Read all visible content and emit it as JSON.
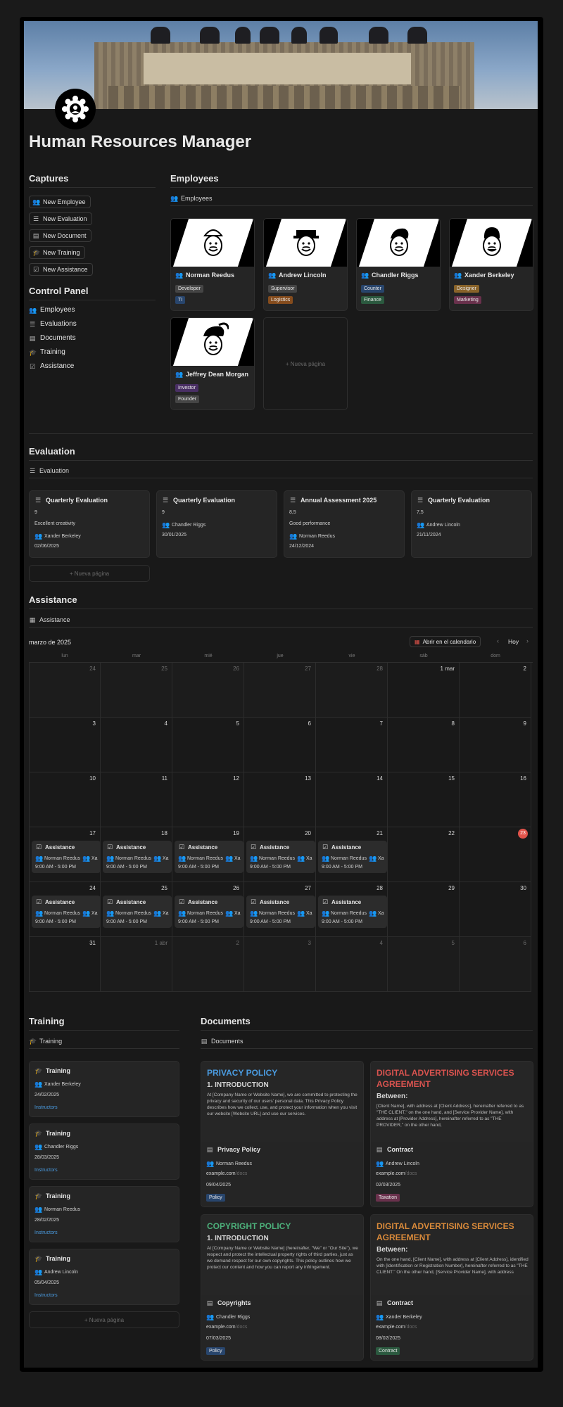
{
  "page": {
    "title": "Human Resources Manager"
  },
  "captures": {
    "heading": "Captures",
    "buttons": [
      "New Employee",
      "New Evaluation",
      "New Document",
      "New Training",
      "New Assistance"
    ]
  },
  "control_panel": {
    "heading": "Control Panel",
    "items": [
      "Employees",
      "Evaluations",
      "Documents",
      "Training",
      "Assistance"
    ]
  },
  "employees": {
    "heading": "Employees",
    "view": "Employees",
    "cards": [
      {
        "name": "Norman Reedus",
        "tags": [
          {
            "label": "Developer",
            "color": "#454545"
          },
          {
            "label": "TI",
            "color": "#28456c"
          }
        ]
      },
      {
        "name": "Andrew Lincoln",
        "tags": [
          {
            "label": "Supervisor",
            "color": "#454545"
          },
          {
            "label": "Logistics",
            "color": "#854c1d"
          }
        ]
      },
      {
        "name": "Chandler Riggs",
        "tags": [
          {
            "label": "Counter",
            "color": "#28456c"
          },
          {
            "label": "Finance",
            "color": "#2b593f"
          }
        ]
      },
      {
        "name": "Xander Berkeley",
        "tags": [
          {
            "label": "Designer",
            "color": "#89632a"
          },
          {
            "label": "Marketing",
            "color": "#69314c"
          }
        ]
      },
      {
        "name": "Jeffrey Dean Morgan",
        "tags": [
          {
            "label": "Investor",
            "color": "#492f64"
          },
          {
            "label": "Founder",
            "color": "#454545"
          }
        ]
      }
    ],
    "new_page": "+ Nueva página"
  },
  "evaluation": {
    "heading": "Evaluation",
    "view": "Evaluation",
    "cards": [
      {
        "title": "Quarterly Evaluation",
        "score": "9",
        "note": "Excellent creativity",
        "person": "Xander Berkeley",
        "date": "02/06/2025"
      },
      {
        "title": "Quarterly Evaluation",
        "score": "9",
        "note": "",
        "person": "Chandler Riggs",
        "date": "30/01/2025"
      },
      {
        "title": "Annual Assessment 2025",
        "score": "8,5",
        "note": "Good performance",
        "person": "Norman Reedus",
        "date": "24/12/2024"
      },
      {
        "title": "Quarterly Evaluation",
        "score": "7,5",
        "note": "",
        "person": "Andrew Lincoln",
        "date": "21/11/2024"
      }
    ],
    "new_page": "+ Nueva página"
  },
  "assistance": {
    "heading": "Assistance",
    "view": "Assistance",
    "month": "marzo de 2025",
    "open_calendar": "Abrir en el calendario",
    "today": "Hoy",
    "weekdays": [
      "lun",
      "mar",
      "mié",
      "jue",
      "vie",
      "sáb",
      "dom"
    ],
    "weeks": [
      [
        {
          "d": "24",
          "dim": true
        },
        {
          "d": "25",
          "dim": true
        },
        {
          "d": "26",
          "dim": true
        },
        {
          "d": "27",
          "dim": true
        },
        {
          "d": "28",
          "dim": true
        },
        {
          "d": "1 mar"
        },
        {
          "d": "2"
        }
      ],
      [
        {
          "d": "3"
        },
        {
          "d": "4"
        },
        {
          "d": "5"
        },
        {
          "d": "6"
        },
        {
          "d": "7"
        },
        {
          "d": "8"
        },
        {
          "d": "9"
        }
      ],
      [
        {
          "d": "10"
        },
        {
          "d": "11"
        },
        {
          "d": "12"
        },
        {
          "d": "13"
        },
        {
          "d": "14"
        },
        {
          "d": "15"
        },
        {
          "d": "16"
        }
      ],
      [
        {
          "d": "17",
          "ev": true
        },
        {
          "d": "18",
          "ev": true
        },
        {
          "d": "19",
          "ev": true
        },
        {
          "d": "20",
          "ev": true
        },
        {
          "d": "21",
          "ev": true
        },
        {
          "d": "22"
        },
        {
          "d": "23",
          "today": true
        }
      ],
      [
        {
          "d": "24",
          "ev": true
        },
        {
          "d": "25",
          "ev": true
        },
        {
          "d": "26",
          "ev": true
        },
        {
          "d": "27",
          "ev": true
        },
        {
          "d": "28",
          "ev": true
        },
        {
          "d": "29"
        },
        {
          "d": "30"
        }
      ],
      [
        {
          "d": "31"
        },
        {
          "d": "1 abr",
          "dim": true
        },
        {
          "d": "2",
          "dim": true
        },
        {
          "d": "3",
          "dim": true
        },
        {
          "d": "4",
          "dim": true
        },
        {
          "d": "5",
          "dim": true
        },
        {
          "d": "6",
          "dim": true
        }
      ]
    ],
    "event": {
      "title": "Assistance",
      "people": "Norman Reedus",
      "people_more": "Xa",
      "time": "9:00 AM - 5:00 PM"
    }
  },
  "training": {
    "heading": "Training",
    "view": "Training",
    "cards": [
      {
        "title": "Training",
        "person": "Xander Berkeley",
        "date": "24/02/2025",
        "type": "Instructors"
      },
      {
        "title": "Training",
        "person": "Chandler Riggs",
        "date": "28/03/2025",
        "type": "Instructors"
      },
      {
        "title": "Training",
        "person": "Norman Reedus",
        "date": "28/02/2025",
        "type": "Instructors"
      },
      {
        "title": "Training",
        "person": "Andrew Lincoln",
        "date": "05/04/2025",
        "type": "Instructors"
      }
    ],
    "new_page": "+ Nueva página"
  },
  "documents": {
    "heading": "Documents",
    "view": "Documents",
    "cards": [
      {
        "preview_title": "PRIVACY POLICY",
        "preview_color": "#4a9be0",
        "preview_h2": "1. INTRODUCTION",
        "preview_text": "At [Company Name or Website Name], we are committed to protecting the privacy and security of our users' personal data. This Privacy Policy describes how we collect, use, and protect your information when you visit our website [Website URL] and use our services.",
        "title": "Privacy Policy",
        "person": "Norman Reedus",
        "url": "example.com",
        "url_path": "/docs",
        "date": "09/04/2025",
        "tag": "Policy",
        "tag_color": "#28456c"
      },
      {
        "preview_title": "DIGITAL ADVERTISING SERVICES AGREEMENT",
        "preview_color": "#d9534f",
        "preview_h2": "Between:",
        "preview_text": "[Client Name], with address at [Client Address], hereinafter referred to as \"THE CLIENT,\" on the one hand, and [Service Provider Name], with address at [Provider Address], hereinafter referred to as \"THE PROVIDER,\" on the other hand,",
        "title": "Contract",
        "person": "Andrew Lincoln",
        "url": "example.com",
        "url_path": "/docs",
        "date": "02/03/2025",
        "tag": "Taxation",
        "tag_color": "#69314c"
      },
      {
        "preview_title": "COPYRIGHT POLICY",
        "preview_color": "#4caf7a",
        "preview_h2": "1. INTRODUCTION",
        "preview_text": "At [Company Name or Website Name] (hereinafter, \"We\" or \"Our Site\"), we respect and protect the intellectual property rights of third parties, just as we demand respect for our own copyrights. This policy outlines how we protect our content and how you can report any infringement.",
        "title": "Copyrights",
        "person": "Chandler Riggs",
        "url": "example.com",
        "url_path": "/docs",
        "date": "07/03/2025",
        "tag": "Policy",
        "tag_color": "#28456c"
      },
      {
        "preview_title": "DIGITAL ADVERTISING SERVICES AGREEMENT",
        "preview_color": "#d98a3a",
        "preview_h2": "Between:",
        "preview_text": "On the one hand, [Client Name], with address at [Client Address], identified with [Identification or Registration Number], hereinafter referred to as \"THE CLIENT.\" On the other hand, [Service Provider Name], with address",
        "title": "Contract",
        "person": "Xander Berkeley",
        "url": "example.com",
        "url_path": "/docs",
        "date": "08/02/2025",
        "tag": "Contract",
        "tag_color": "#2b593f"
      }
    ]
  }
}
